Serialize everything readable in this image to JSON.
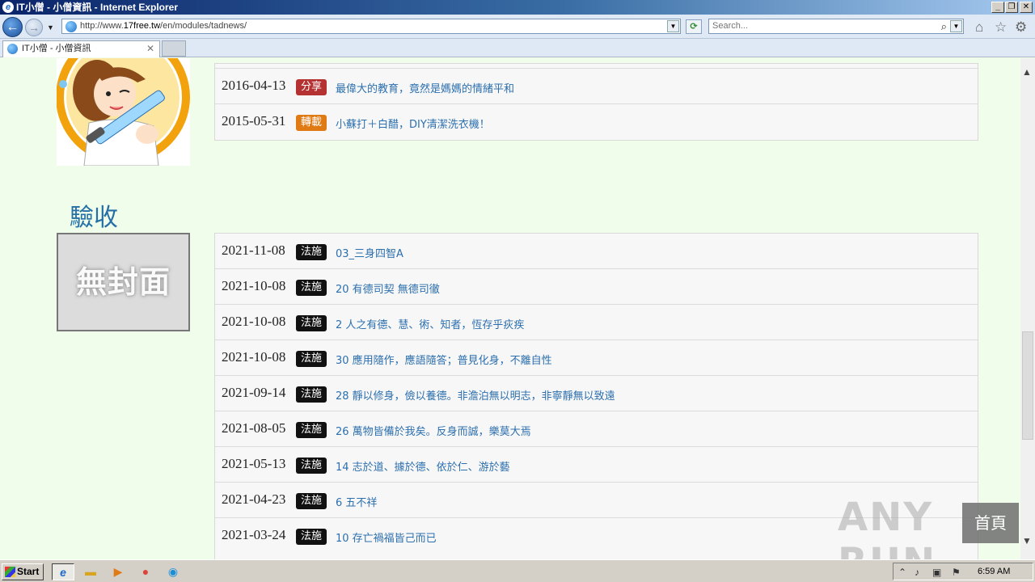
{
  "window": {
    "title": "IT小僧 - 小僧資訊 - Internet Explorer",
    "app_icon": "e",
    "min_label": "_",
    "max_label": "❐",
    "close_label": "✕"
  },
  "nav": {
    "back_icon": "←",
    "forward_icon": "→",
    "dropdown_icon": "▼",
    "url_scheme": "http://www.",
    "url_host": "17free.tw",
    "url_path": "/en/modules/tadnews/",
    "search_placeholder": "Search...",
    "search_icon": "⌕",
    "home_icon": "⌂",
    "favorites_icon": "☆",
    "tools_icon": "⚙"
  },
  "tabs": [
    {
      "title": "IT小僧 - 小僧資訊",
      "close": "✕"
    }
  ],
  "section_title": "驗收",
  "no_cover_text": "無封面",
  "badge_colors": {
    "分享": "#b53232",
    "轉載": "#e07a14",
    "法施": "#111111"
  },
  "news_top": [
    {
      "date": "2016-04-13",
      "badge": "分享",
      "title": "最偉大的教育，竟然是媽媽的情緒平和"
    },
    {
      "date": "2015-05-31",
      "badge": "轉載",
      "title": "小蘇打＋白醋，DIY清潔洗衣機！"
    }
  ],
  "news_bottom": [
    {
      "date": "2021-11-08",
      "badge": "法施",
      "title": "03_三身四智A"
    },
    {
      "date": "2021-10-08",
      "badge": "法施",
      "title": "20 有德司契 無德司徹"
    },
    {
      "date": "2021-10-08",
      "badge": "法施",
      "title": "2 人之有德、慧、術、知者，恆存乎疢疾"
    },
    {
      "date": "2021-10-08",
      "badge": "法施",
      "title": "30 應用隨作，應語隨答；普見化身，不離自性"
    },
    {
      "date": "2021-09-14",
      "badge": "法施",
      "title": "28 靜以修身，儉以養德。非澹泊無以明志，非寧靜無以致遠"
    },
    {
      "date": "2021-08-05",
      "badge": "法施",
      "title": "26 萬物皆備於我矣。反身而誠，樂莫大焉"
    },
    {
      "date": "2021-05-13",
      "badge": "法施",
      "title": "14 志於道、據於德、依於仁、游於藝"
    },
    {
      "date": "2021-04-23",
      "badge": "法施",
      "title": "6 五不祥"
    },
    {
      "date": "2021-03-24",
      "badge": "法施",
      "title": "10 存亡禍福皆己而已"
    }
  ],
  "watermark_text": "ANY RUN",
  "home_float_label": "首頁",
  "taskbar": {
    "start_label": "Start",
    "clock": "6:59 AM"
  }
}
